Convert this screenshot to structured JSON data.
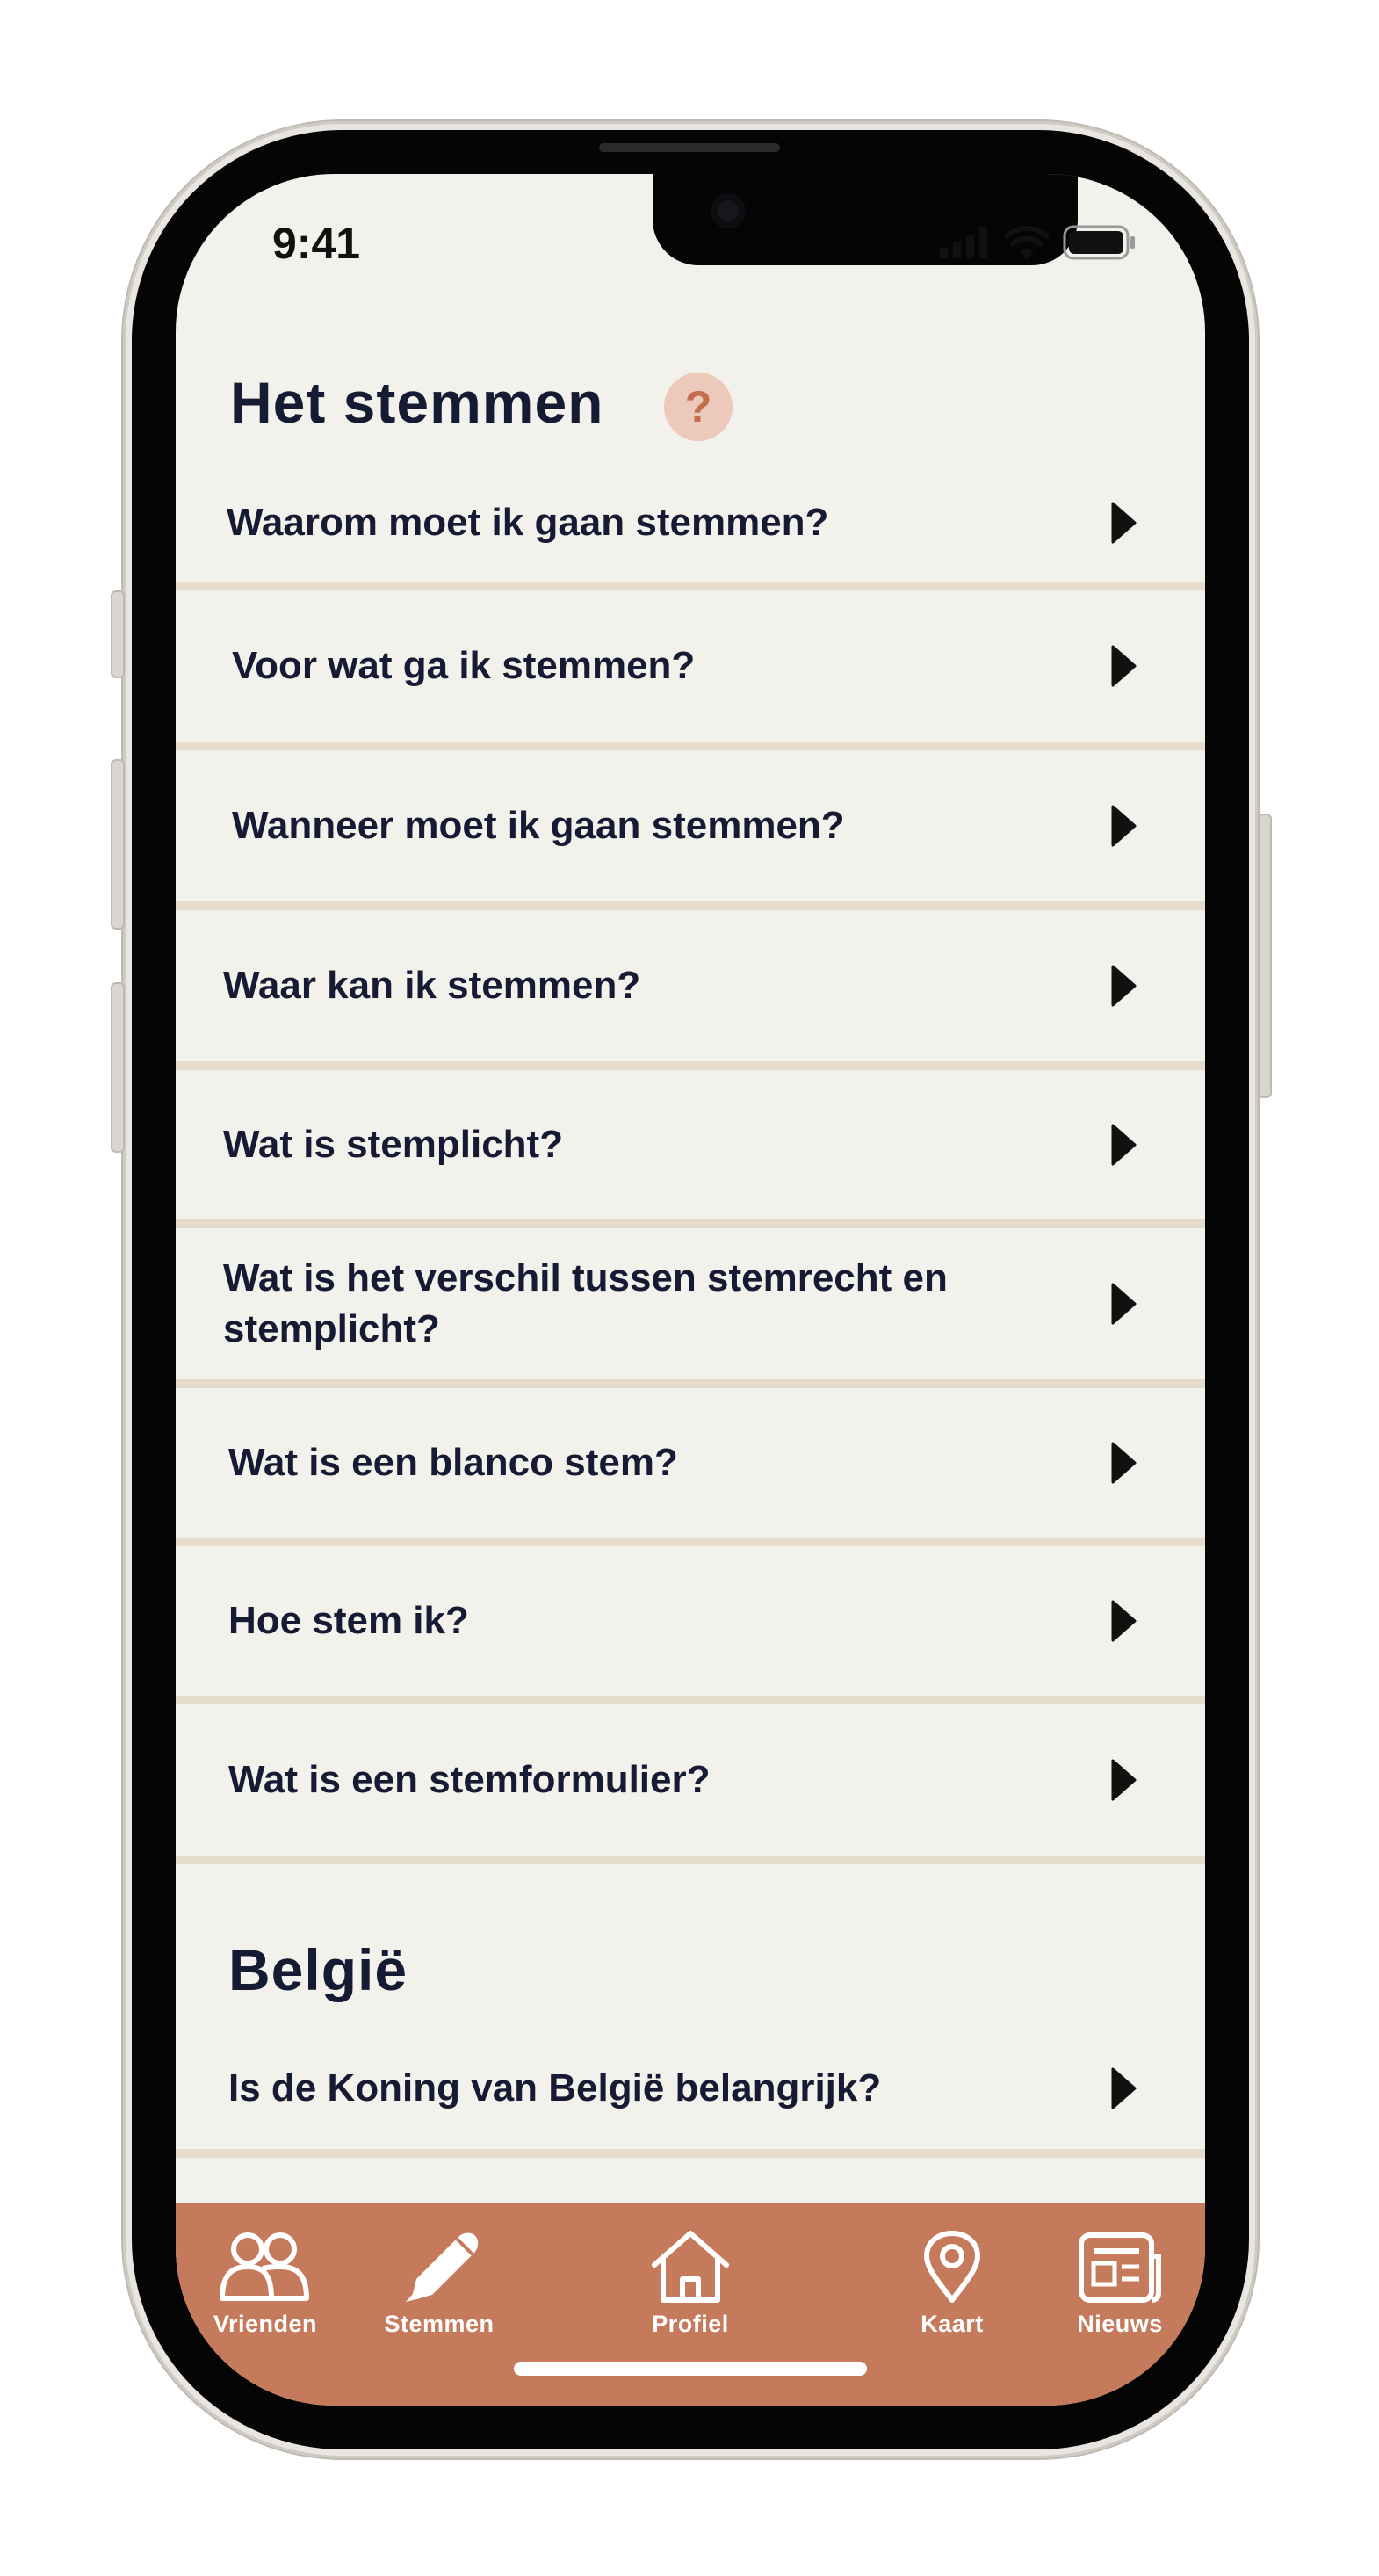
{
  "status_bar": {
    "time": "9:41"
  },
  "sections": [
    {
      "title": "Het stemmen",
      "help_symbol": "?",
      "items": [
        "Waarom moet ik gaan stemmen?",
        "Voor wat ga ik stemmen?",
        "Wanneer moet ik gaan stemmen?",
        "Waar kan ik stemmen?",
        "Wat is stemplicht?",
        "Wat is het verschil tussen stemrecht en stemplicht?",
        "Wat is een blanco stem?",
        "Hoe stem ik?",
        "Wat is een stemformulier?"
      ]
    },
    {
      "title": "België",
      "items": [
        "Is de Koning van België belangrijk?"
      ]
    }
  ],
  "tabbar": {
    "items": [
      {
        "label": "Vrienden",
        "icon": "friends-icon"
      },
      {
        "label": "Stemmen",
        "icon": "pen-icon"
      },
      {
        "label": "Profiel",
        "icon": "home-icon"
      },
      {
        "label": "Kaart",
        "icon": "map-pin-icon"
      },
      {
        "label": "Nieuws",
        "icon": "newspaper-icon"
      }
    ]
  },
  "colors": {
    "background": "#f2f1ec",
    "divider": "#e5dccb",
    "text": "#161b33",
    "tabbar": "#c67a5c",
    "help_badge_bg": "#edc9bc",
    "help_badge_fg": "#c46d4c"
  }
}
